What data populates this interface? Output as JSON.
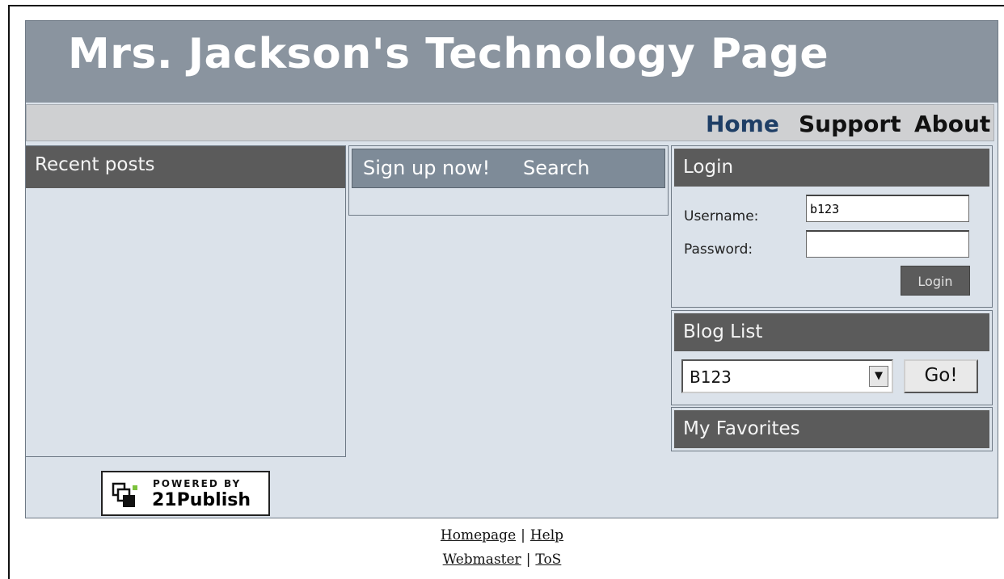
{
  "header": {
    "title": "Mrs. Jackson's Technology Page"
  },
  "nav": {
    "items": [
      {
        "label": "Home",
        "active": true
      },
      {
        "label": "Support"
      },
      {
        "label": "About"
      }
    ]
  },
  "left_column": {
    "title": "Recent posts"
  },
  "middle_column": {
    "tabs": [
      "Sign up now!",
      "Search"
    ]
  },
  "login": {
    "title": "Login",
    "username_label": "Username:",
    "username_value": "b123",
    "password_label": "Password:",
    "password_value": "",
    "button_label": "Login"
  },
  "blog_list": {
    "title": "Blog List",
    "selected": "B123",
    "arrow": "▼",
    "go_label": "Go!"
  },
  "favorites": {
    "title": "My Favorites"
  },
  "powered_by": {
    "small": "POWERED BY",
    "brand": "21Publish"
  },
  "footer": {
    "links": [
      "Homepage",
      "Help",
      "Webmaster",
      "ToS"
    ],
    "separator": "|"
  },
  "colors": {
    "header_bg": "#8a949f",
    "page_bg": "#dbe2ea",
    "box_title_bg": "#5b5b5b",
    "active_nav": "#1e3e66"
  }
}
